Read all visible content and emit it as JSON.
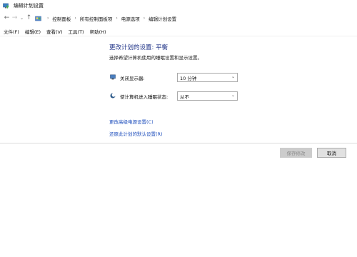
{
  "window": {
    "title": "编辑计划设置"
  },
  "nav": {
    "back": "←",
    "forward": "→",
    "recent": "⌄",
    "up": "↑",
    "breadcrumbs": [
      "控制面板",
      "所有控制面板项",
      "电源选项",
      "编辑计划设置"
    ]
  },
  "menu": {
    "items": [
      "文件(F)",
      "编辑(E)",
      "查看(V)",
      "工具(T)",
      "帮助(H)"
    ]
  },
  "main": {
    "title": "更改计划的设置: 平衡",
    "description": "选择希望计算机使用的睡眠设置和显示设置。",
    "display_off_label": "关闭显示器:",
    "display_off_value": "10 分钟",
    "sleep_label": "使计算机进入睡眠状态:",
    "sleep_value": "从不",
    "advanced_link": "更改高级电源设置(C)",
    "restore_link": "还原此计划的默认设置(R)"
  },
  "buttons": {
    "save": "保存修改",
    "cancel": "取消"
  },
  "colors": {
    "title_blue": "#1e3287",
    "link_blue": "#1f4fbd"
  }
}
